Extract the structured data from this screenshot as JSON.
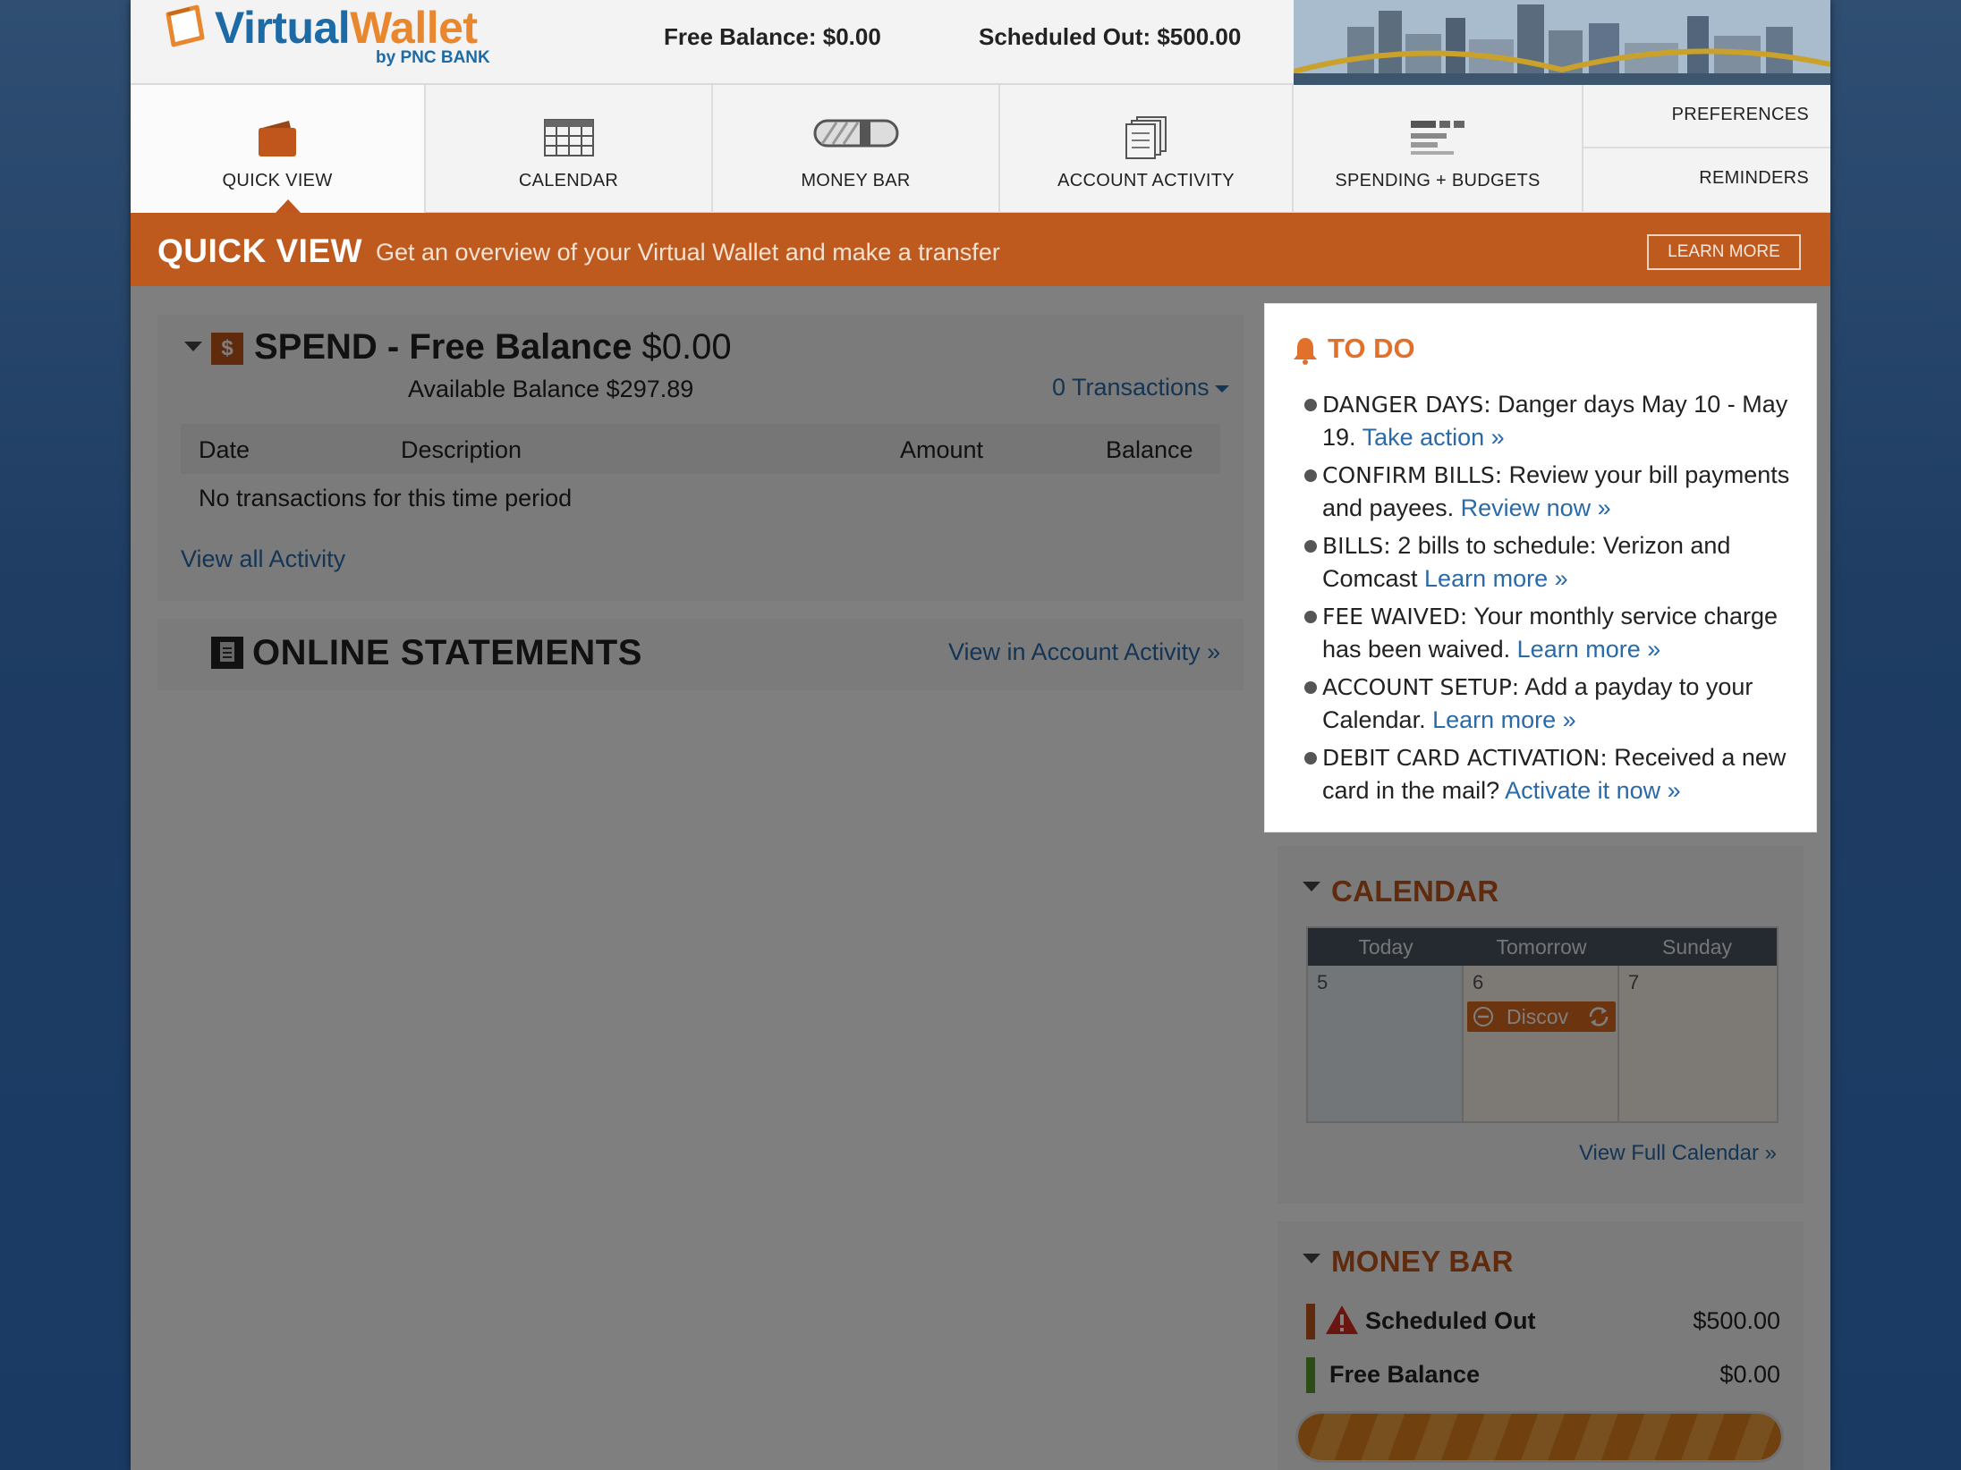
{
  "header": {
    "logo_virtual": "Virtual",
    "logo_wallet": "Wallet",
    "logo_sub": "by PNC BANK",
    "free_balance": "Free Balance: $0.00",
    "scheduled_out": "Scheduled Out: $500.00"
  },
  "nav": {
    "tabs": [
      {
        "label": "QUICK VIEW",
        "icon": "wallet-icon"
      },
      {
        "label": "CALENDAR",
        "icon": "calendar-grid-icon"
      },
      {
        "label": "MONEY BAR",
        "icon": "money-bar-icon"
      },
      {
        "label": "ACCOUNT ACTIVITY",
        "icon": "documents-icon"
      },
      {
        "label": "SPENDING + BUDGETS",
        "icon": "budget-bars-icon"
      }
    ],
    "preferences": "PREFERENCES",
    "reminders": "REMINDERS"
  },
  "banner": {
    "title": "QUICK VIEW",
    "subtitle": "Get an overview of your Virtual Wallet and make a transfer",
    "learn_more": "LEARN MORE"
  },
  "spend": {
    "title": "SPEND - Free Balance",
    "amount": "$0.00",
    "available": "Available Balance $297.89",
    "transactions": "0 Transactions",
    "columns": [
      "Date",
      "Description",
      "Amount",
      "Balance"
    ],
    "empty": "No transactions for this time period",
    "view_all": "View all Activity"
  },
  "statements": {
    "title": "ONLINE STATEMENTS",
    "link": "View in Account Activity »"
  },
  "todo": {
    "title": "TO DO",
    "items": [
      {
        "tag": "DANGER DAYS:",
        "text": " Danger days May 10 - May 19. ",
        "link": "Take action »"
      },
      {
        "tag": "CONFIRM BILLS:",
        "text": " Review your bill payments and payees. ",
        "link": "Review now »"
      },
      {
        "tag": "BILLS:",
        "text": " 2 bills to schedule: Verizon and Comcast ",
        "link": "Learn more »"
      },
      {
        "tag": "FEE WAIVED:",
        "text": " Your monthly service charge has been waived. ",
        "link": "Learn more »"
      },
      {
        "tag": "ACCOUNT SETUP:",
        "text": " Add a payday to your Calendar. ",
        "link": "Learn more »"
      },
      {
        "tag": "DEBIT CARD ACTIVATION:",
        "text": " Received a new card in the mail? ",
        "link": "Activate it now »"
      }
    ]
  },
  "calendar": {
    "title": "CALENDAR",
    "days": [
      "Today",
      "Tomorrow",
      "Sunday"
    ],
    "dates": [
      "5",
      "6",
      "7"
    ],
    "event": "Discov",
    "view_full": "View Full Calendar »"
  },
  "money_bar": {
    "title": "MONEY BAR",
    "rows": [
      {
        "label": "Scheduled Out",
        "value": "$500.00",
        "color": "#c0561b"
      },
      {
        "label": "Free Balance",
        "value": "$0.00",
        "color": "#5a9a2e"
      }
    ],
    "fill_fraction": 1.0
  },
  "colors": {
    "accent": "#c0561b",
    "link": "#2a6aa8",
    "todo_title": "#e0702a"
  }
}
